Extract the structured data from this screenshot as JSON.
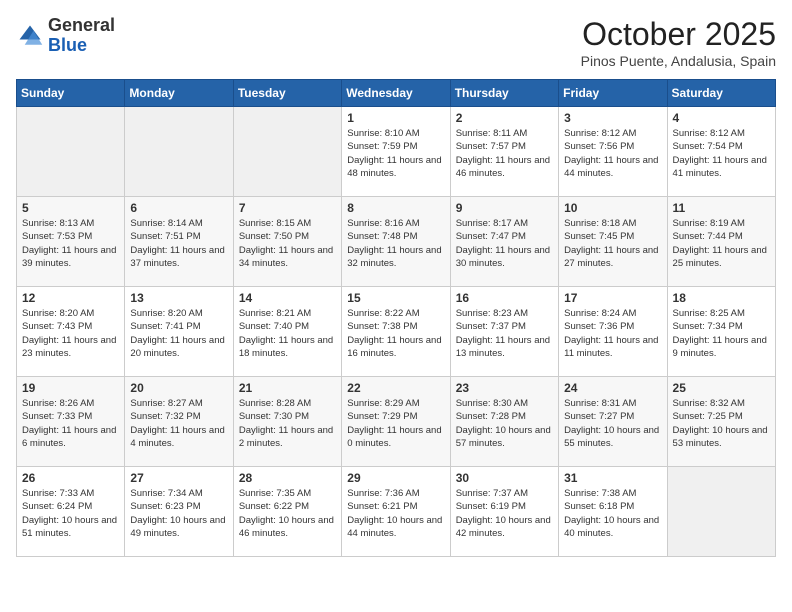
{
  "header": {
    "logo_general": "General",
    "logo_blue": "Blue",
    "month_title": "October 2025",
    "location": "Pinos Puente, Andalusia, Spain"
  },
  "days_of_week": [
    "Sunday",
    "Monday",
    "Tuesday",
    "Wednesday",
    "Thursday",
    "Friday",
    "Saturday"
  ],
  "weeks": [
    [
      {
        "day": "",
        "info": ""
      },
      {
        "day": "",
        "info": ""
      },
      {
        "day": "",
        "info": ""
      },
      {
        "day": "1",
        "info": "Sunrise: 8:10 AM\nSunset: 7:59 PM\nDaylight: 11 hours and 48 minutes."
      },
      {
        "day": "2",
        "info": "Sunrise: 8:11 AM\nSunset: 7:57 PM\nDaylight: 11 hours and 46 minutes."
      },
      {
        "day": "3",
        "info": "Sunrise: 8:12 AM\nSunset: 7:56 PM\nDaylight: 11 hours and 44 minutes."
      },
      {
        "day": "4",
        "info": "Sunrise: 8:12 AM\nSunset: 7:54 PM\nDaylight: 11 hours and 41 minutes."
      }
    ],
    [
      {
        "day": "5",
        "info": "Sunrise: 8:13 AM\nSunset: 7:53 PM\nDaylight: 11 hours and 39 minutes."
      },
      {
        "day": "6",
        "info": "Sunrise: 8:14 AM\nSunset: 7:51 PM\nDaylight: 11 hours and 37 minutes."
      },
      {
        "day": "7",
        "info": "Sunrise: 8:15 AM\nSunset: 7:50 PM\nDaylight: 11 hours and 34 minutes."
      },
      {
        "day": "8",
        "info": "Sunrise: 8:16 AM\nSunset: 7:48 PM\nDaylight: 11 hours and 32 minutes."
      },
      {
        "day": "9",
        "info": "Sunrise: 8:17 AM\nSunset: 7:47 PM\nDaylight: 11 hours and 30 minutes."
      },
      {
        "day": "10",
        "info": "Sunrise: 8:18 AM\nSunset: 7:45 PM\nDaylight: 11 hours and 27 minutes."
      },
      {
        "day": "11",
        "info": "Sunrise: 8:19 AM\nSunset: 7:44 PM\nDaylight: 11 hours and 25 minutes."
      }
    ],
    [
      {
        "day": "12",
        "info": "Sunrise: 8:20 AM\nSunset: 7:43 PM\nDaylight: 11 hours and 23 minutes."
      },
      {
        "day": "13",
        "info": "Sunrise: 8:20 AM\nSunset: 7:41 PM\nDaylight: 11 hours and 20 minutes."
      },
      {
        "day": "14",
        "info": "Sunrise: 8:21 AM\nSunset: 7:40 PM\nDaylight: 11 hours and 18 minutes."
      },
      {
        "day": "15",
        "info": "Sunrise: 8:22 AM\nSunset: 7:38 PM\nDaylight: 11 hours and 16 minutes."
      },
      {
        "day": "16",
        "info": "Sunrise: 8:23 AM\nSunset: 7:37 PM\nDaylight: 11 hours and 13 minutes."
      },
      {
        "day": "17",
        "info": "Sunrise: 8:24 AM\nSunset: 7:36 PM\nDaylight: 11 hours and 11 minutes."
      },
      {
        "day": "18",
        "info": "Sunrise: 8:25 AM\nSunset: 7:34 PM\nDaylight: 11 hours and 9 minutes."
      }
    ],
    [
      {
        "day": "19",
        "info": "Sunrise: 8:26 AM\nSunset: 7:33 PM\nDaylight: 11 hours and 6 minutes."
      },
      {
        "day": "20",
        "info": "Sunrise: 8:27 AM\nSunset: 7:32 PM\nDaylight: 11 hours and 4 minutes."
      },
      {
        "day": "21",
        "info": "Sunrise: 8:28 AM\nSunset: 7:30 PM\nDaylight: 11 hours and 2 minutes."
      },
      {
        "day": "22",
        "info": "Sunrise: 8:29 AM\nSunset: 7:29 PM\nDaylight: 11 hours and 0 minutes."
      },
      {
        "day": "23",
        "info": "Sunrise: 8:30 AM\nSunset: 7:28 PM\nDaylight: 10 hours and 57 minutes."
      },
      {
        "day": "24",
        "info": "Sunrise: 8:31 AM\nSunset: 7:27 PM\nDaylight: 10 hours and 55 minutes."
      },
      {
        "day": "25",
        "info": "Sunrise: 8:32 AM\nSunset: 7:25 PM\nDaylight: 10 hours and 53 minutes."
      }
    ],
    [
      {
        "day": "26",
        "info": "Sunrise: 7:33 AM\nSunset: 6:24 PM\nDaylight: 10 hours and 51 minutes."
      },
      {
        "day": "27",
        "info": "Sunrise: 7:34 AM\nSunset: 6:23 PM\nDaylight: 10 hours and 49 minutes."
      },
      {
        "day": "28",
        "info": "Sunrise: 7:35 AM\nSunset: 6:22 PM\nDaylight: 10 hours and 46 minutes."
      },
      {
        "day": "29",
        "info": "Sunrise: 7:36 AM\nSunset: 6:21 PM\nDaylight: 10 hours and 44 minutes."
      },
      {
        "day": "30",
        "info": "Sunrise: 7:37 AM\nSunset: 6:19 PM\nDaylight: 10 hours and 42 minutes."
      },
      {
        "day": "31",
        "info": "Sunrise: 7:38 AM\nSunset: 6:18 PM\nDaylight: 10 hours and 40 minutes."
      },
      {
        "day": "",
        "info": ""
      }
    ]
  ]
}
